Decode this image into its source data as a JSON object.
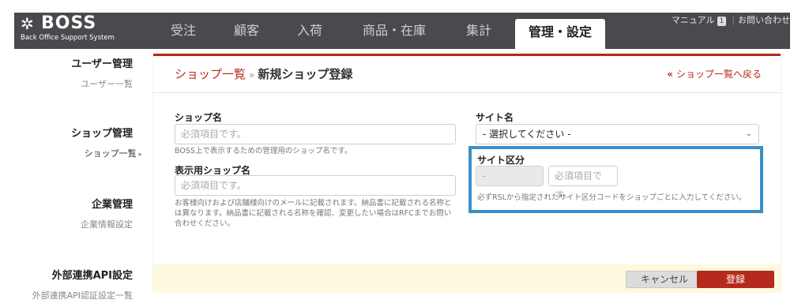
{
  "brand": {
    "name": "BOSS",
    "subtitle": "Back Office Support System",
    "logo_icon": "pinwheel-logo-icon"
  },
  "nav": {
    "tabs": [
      {
        "label": "受注"
      },
      {
        "label": "顧客"
      },
      {
        "label": "入荷"
      },
      {
        "label": "商品・在庫"
      },
      {
        "label": "集計"
      },
      {
        "label": "管理・設定"
      }
    ],
    "active_tab": "管理・設定"
  },
  "utility": {
    "manual_label": "マニュアル",
    "manual_badge": "1",
    "contact_label": "お問い合わせ"
  },
  "sidebar": {
    "sections": [
      {
        "heading": "ユーザー管理",
        "items": [
          "ユーザー一覧"
        ]
      },
      {
        "heading": "ショップ管理",
        "items": [
          "ショップ一覧"
        ]
      },
      {
        "heading": "企業管理",
        "items": [
          "企業情報設定"
        ]
      },
      {
        "heading": "外部連携API設定",
        "items": [
          "外部連携API認証設定一覧"
        ]
      }
    ],
    "current_item": "ショップ一覧"
  },
  "page": {
    "breadcrumb_link": "ショップ一覧",
    "breadcrumb_separator": "»",
    "breadcrumb_current": "新規ショップ登録",
    "back_link": "ショップ一覧へ戻る"
  },
  "form": {
    "shop_name": {
      "label": "ショップ名",
      "placeholder": "必須項目です。",
      "help": "BOSS上で表示するための管理用のショップ名です。"
    },
    "display_shop_name": {
      "label": "表示用ショップ名",
      "placeholder": "必須項目です。",
      "help": "お客様向けおよび店舗様向けのメールに記載されます。納品書に記載される名称とは異なります。納品書に記載される名称を確認、変更したい場合はRFCまでお問い合わせください。"
    },
    "site_name": {
      "label": "サイト名",
      "selected": "- 選択してください -"
    },
    "site_category": {
      "label": "サイト区分",
      "prefix_value": "-",
      "placeholder": "必須項目です。",
      "help": "必ずRSLから指定されたサイト区分コードをショップごとに入力してください。"
    }
  },
  "actions": {
    "cancel_label": "キャンセル",
    "submit_label": "登録"
  },
  "colors": {
    "accent": "#b52a1d",
    "nav_bg": "#4a4a4e",
    "highlight_border": "#3a8fc9",
    "footer_bg": "#fdf9df"
  }
}
